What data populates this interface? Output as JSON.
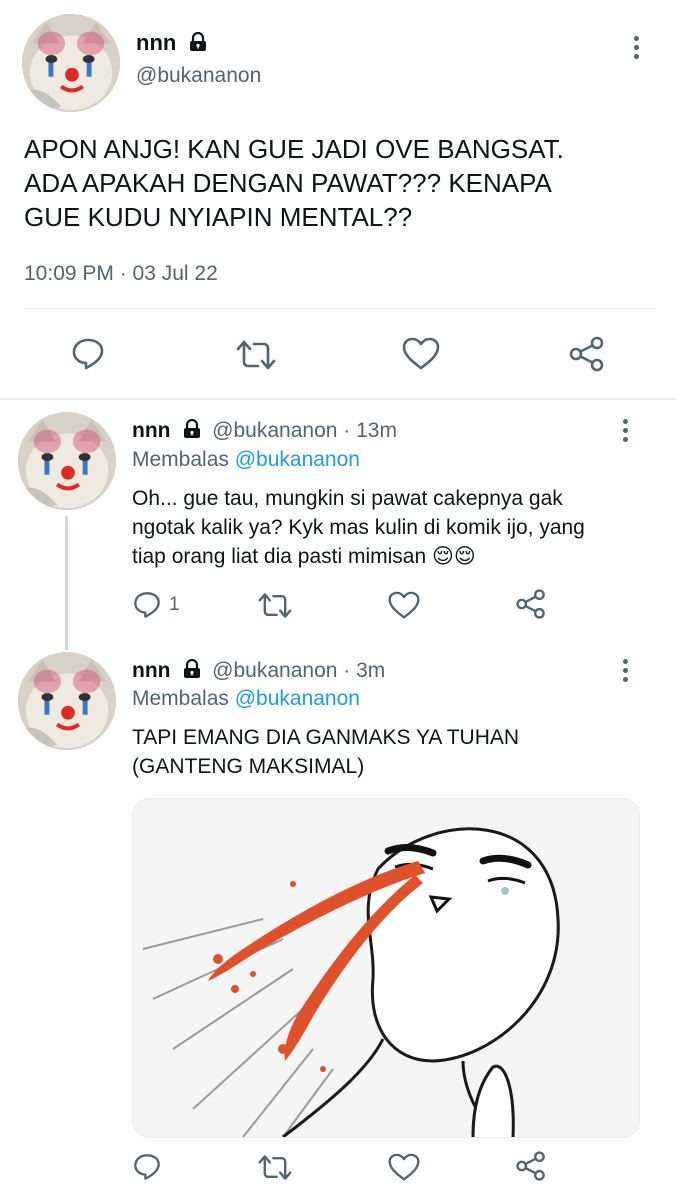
{
  "main_tweet": {
    "display_name": "nnn",
    "handle": "@bukananon",
    "text_lines": [
      "APON ANJG! KAN GUE JADI OVE BANGSAT.",
      "ADA APAKAH DENGAN PAWAT??? KENAPA",
      "GUE KUDU NYIAPIN MENTAL??"
    ],
    "timestamp": "10:09 PM · 03 Jul 22"
  },
  "replies": [
    {
      "display_name": "nnn",
      "handle_time": "@bukananon · 13m",
      "replying_label": "Membalas",
      "replying_to": "@bukananon",
      "text_lines": [
        "Oh... gue tau, mungkin si pawat cakepnya gak",
        "ngotak kalik ya? Kyk mas kulin di komik ijo, yang",
        "tiap orang liat dia pasti mimisan"
      ],
      "emoji": "😌😌",
      "reply_count": "1"
    },
    {
      "display_name": "nnn",
      "handle_time": "@bukananon · 3m",
      "replying_label": "Membalas",
      "replying_to": "@bukananon",
      "text_lines": [
        "TAPI EMANG DIA GANMAKS YA TUHAN",
        "(GANTENG MAKSIMAL)"
      ]
    }
  ],
  "icons": [
    "more-icon",
    "lock-icon",
    "reply-icon",
    "retweet-icon",
    "like-icon",
    "share-icon"
  ],
  "colors": {
    "text": "#0f1419",
    "muted": "#536471",
    "accent": "#1d9bf0",
    "blood": "#e0502a"
  }
}
